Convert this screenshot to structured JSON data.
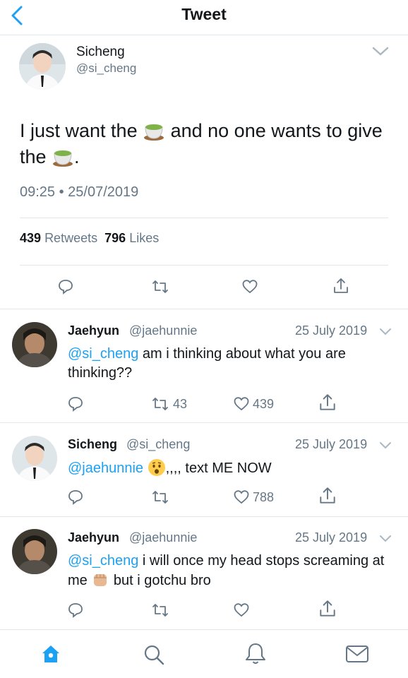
{
  "header": {
    "title": "Tweet"
  },
  "tweet": {
    "name": "Sicheng",
    "handle": "@si_cheng",
    "text_part1": "I just want the ",
    "text_part2": " and no one wants to give the ",
    "text_part3": ".",
    "timestamp": "09:25 • 25/07/2019",
    "retweets_count": "439",
    "retweets_label": "Retweets",
    "likes_count": "796",
    "likes_label": "Likes"
  },
  "replies": [
    {
      "name": "Jaehyun",
      "handle": "@jaehunnie",
      "date": "25 July 2019",
      "mention": "@si_cheng",
      "text": " am i thinking about what you are thinking??",
      "retweets": "43",
      "likes": "439"
    },
    {
      "name": "Sicheng",
      "handle": "@si_cheng",
      "date": "25 July 2019",
      "mention": "@jaehunnie",
      "text_after_emoji": ",,,, text ME NOW",
      "retweets": "",
      "likes": "788"
    },
    {
      "name": "Jaehyun",
      "handle": "@jaehunnie",
      "date": "25 July 2019",
      "mention": "@si_cheng",
      "text_part1": " i will once my head stops screaming at me ",
      "text_part2": " but i gotchu bro",
      "retweets": "",
      "likes": ""
    }
  ],
  "colors": {
    "accent": "#1da1f2",
    "secondary_text": "#657786",
    "divider": "#e1e8ed"
  },
  "icons": [
    "back-icon",
    "chevron-down-icon",
    "tea-emoji",
    "reply-icon",
    "retweet-icon",
    "like-icon",
    "share-icon",
    "worried-face-emoji",
    "fist-emoji",
    "home-icon",
    "search-icon",
    "notifications-icon",
    "messages-icon"
  ]
}
